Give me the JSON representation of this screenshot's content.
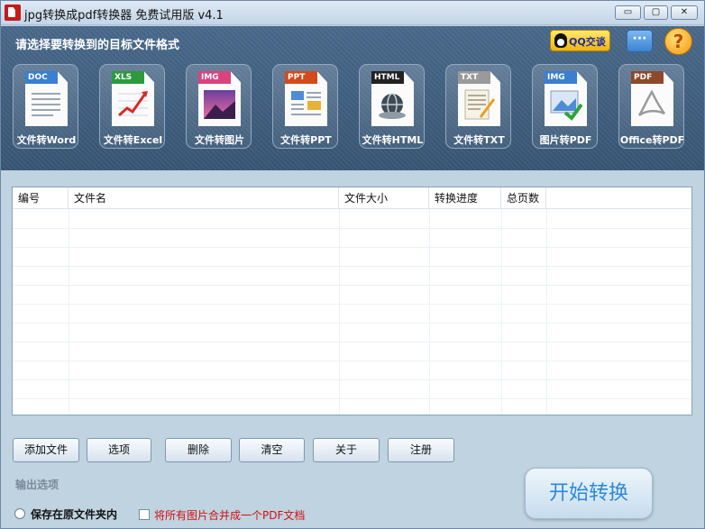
{
  "window": {
    "title": "jpg转换成pdf转换器 免费试用版 v4.1",
    "controls": {
      "minimize": "▭",
      "maximize": "▢",
      "close": "✕"
    }
  },
  "header": {
    "prompt": "请选择要转换到的目标文件格式",
    "qq_label": "QQ交谈",
    "message_icon": "···",
    "help_icon": "?"
  },
  "tools": [
    {
      "band": "DOC",
      "label": "文件转Word",
      "icon": "word-doc-icon",
      "color": "#3b7fd0"
    },
    {
      "band": "XLS",
      "label": "文件转Excel",
      "icon": "excel-chart-icon",
      "color": "#2f9a3d"
    },
    {
      "band": "IMG",
      "label": "文件转图片",
      "icon": "image-file-icon",
      "color": "#d9437f"
    },
    {
      "band": "PPT",
      "label": "文件转PPT",
      "icon": "ppt-file-icon",
      "color": "#d44b1b"
    },
    {
      "band": "HTML",
      "label": "文件转HTML",
      "icon": "html-globe-icon",
      "color": "#222222"
    },
    {
      "band": "TXT",
      "label": "文件转TXT",
      "icon": "txt-file-icon",
      "color": "#9a9a9a"
    },
    {
      "band": "IMG",
      "label": "图片转PDF",
      "icon": "image-to-pdf-icon",
      "color": "#3b7fd0"
    },
    {
      "band": "PDF",
      "label": "Office转PDF",
      "icon": "pdf-acrobat-icon",
      "color": "#8b4a2b"
    }
  ],
  "table": {
    "columns": [
      "编号",
      "文件名",
      "文件大小",
      "转换进度",
      "总页数"
    ],
    "rows": []
  },
  "buttons": {
    "add": "添加文件",
    "options": "选项",
    "delete": "删除",
    "clear": "清空",
    "about": "关于",
    "register": "注册"
  },
  "output": {
    "section_label": "输出选项",
    "radio_label": "保存在原文件夹内",
    "merge_label": "将所有图片合并成一个PDF文档"
  },
  "start_label": "开始转换"
}
